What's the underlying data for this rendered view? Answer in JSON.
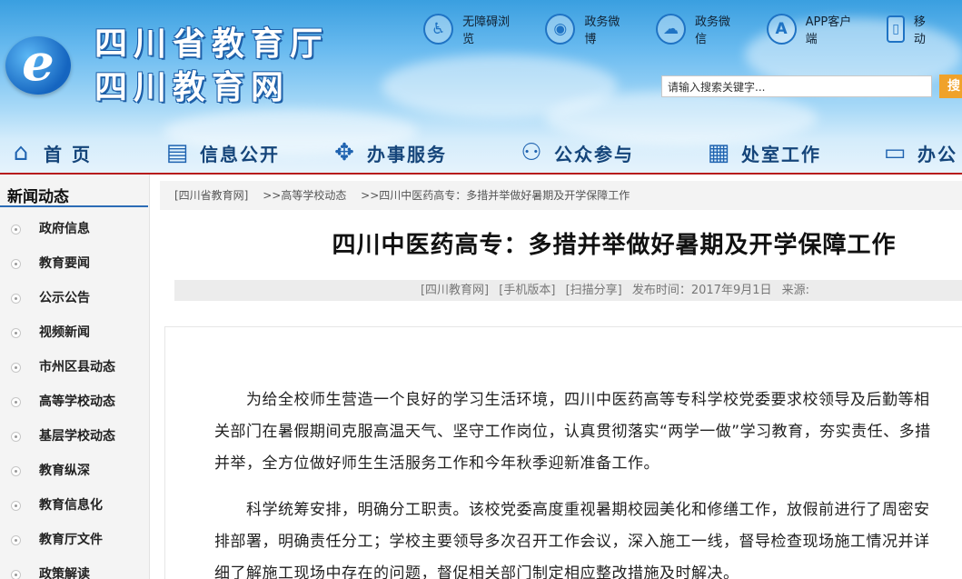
{
  "site": {
    "title_line1": "四川省教育厅",
    "title_line2": "四川教育网",
    "logo_letter": "e"
  },
  "toplinks": [
    {
      "label": "无障碍浏览",
      "icon": "accessibility-icon",
      "glyph": "♿"
    },
    {
      "label": "政务微博",
      "icon": "weibo-icon",
      "glyph": "◉"
    },
    {
      "label": "政务微信",
      "icon": "wechat-icon",
      "glyph": "☁"
    },
    {
      "label": "APP客户端",
      "icon": "app-store-icon",
      "glyph": "A"
    },
    {
      "label": "移动",
      "icon": "phone-icon",
      "glyph": "▯"
    }
  ],
  "search": {
    "placeholder": "请输入搜索关键字...",
    "button_label": "搜"
  },
  "nav": [
    {
      "label": "首 页",
      "icon": "home-icon",
      "glyph": "⌂"
    },
    {
      "label": "信息公开",
      "icon": "document-list-icon",
      "glyph": "▤"
    },
    {
      "label": "办事服务",
      "icon": "service-gear-icon",
      "glyph": "✥"
    },
    {
      "label": "公众参与",
      "icon": "user-settings-icon",
      "glyph": "⚇"
    },
    {
      "label": "处室工作",
      "icon": "calendar-icon",
      "glyph": "▦"
    },
    {
      "label": "办公",
      "icon": "monitor-icon",
      "glyph": "▭"
    }
  ],
  "sidebar": {
    "title": "新闻动态",
    "items": [
      "政府信息",
      "教育要闻",
      "公示公告",
      "视频新闻",
      "市州区县动态",
      "高等学校动态",
      "基层学校动态",
      "教育纵深",
      "教育信息化",
      "教育厅文件",
      "政策解读"
    ]
  },
  "breadcrumb": [
    "[四川省教育网]",
    ">>高等学校动态",
    ">>四川中医药高专：多措并举做好暑期及开学保障工作"
  ],
  "article": {
    "title": "四川中医药高专：多措并举做好暑期及开学保障工作",
    "meta": {
      "source_link": "[四川教育网]",
      "mobile_link": "[手机版本]",
      "share_link": "[扫描分享]",
      "publish_time": "发布时间：2017年9月1日",
      "source": "来源:"
    },
    "paragraphs": [
      "为给全校师生营造一个良好的学习生活环境，四川中医药高等专科学校党委要求校领导及后勤等相关部门在暑假期间克服高温天气、坚守工作岗位，认真贯彻落实“两学一做”学习教育，夯实责任、多措并举，全方位做好师生生活服务工作和今年秋季迎新准备工作。",
      "科学统筹安排，明确分工职责。该校党委高度重视暑期校园美化和修缮工作，放假前进行了周密安排部署，明确责任分工；学校主要领导多次召开工作会议，深入施工一线，督导检查现场施工情况并详细了解施工现场中存在的问题，督促相关部门制定相应整改措施及时解决。"
    ]
  },
  "colors": {
    "nav_divider": "#b71c1c",
    "nav_text": "#15457a",
    "search_button": "#f0a22a",
    "sidebar_underline": "#2b6cb6"
  }
}
